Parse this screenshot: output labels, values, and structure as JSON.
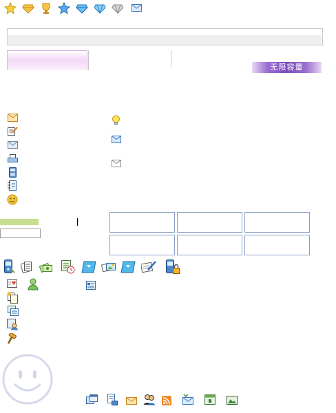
{
  "toolbar_top": {
    "icons": [
      "star-gold-icon",
      "diamond-gold-icon",
      "trophy-icon",
      "star-blue-icon",
      "diamond-blue-icon",
      "diamond-blue-2-icon",
      "diamond-gray-icon",
      "mail-icon"
    ]
  },
  "badge": {
    "label": "无限容量"
  },
  "colors": {
    "tab_pink": "#f3d8f7",
    "bar_gray": "#eeeeee",
    "badge_purple": "#7c4cbd",
    "green_bar": "#c7df8e",
    "cell_border": "#8aa0c8"
  },
  "left_menu": {
    "icons": [
      "envelope-icon",
      "compose-icon",
      "inbox-icon",
      "printer-icon",
      "phone-icon",
      "address-book-icon",
      "smiley-icon"
    ]
  },
  "middle_menu": {
    "icons": [
      "lightbulb-icon",
      "mail-icon",
      "envelope-outline-icon"
    ]
  },
  "tool_row": {
    "icons": [
      "mobile-icon",
      "documents-icon",
      "money-icon",
      "calendar-clock-icon",
      "disk-icon",
      "photos-icon",
      "disk-2-icon",
      "write-icon",
      "mobile-lock-icon"
    ]
  },
  "side_list": {
    "icons": [
      "greeting-card-icon",
      "user-icon",
      "card-icon",
      "copy-icon",
      "notes-icon",
      "contacts-icon",
      "hammer-icon"
    ]
  },
  "footer": {
    "icons": [
      "windows-icon",
      "document-icon",
      "mail-icon",
      "people-icon",
      "rss-icon",
      "mail-receive-icon",
      "calendar-icon",
      "image-icon"
    ]
  }
}
